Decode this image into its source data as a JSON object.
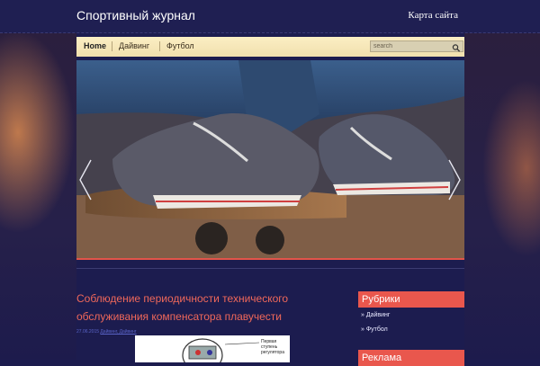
{
  "header": {
    "site_title": "Спортивный журнал",
    "sitemap_link": "Карта сайта"
  },
  "nav": {
    "items": [
      {
        "label": "Home",
        "active": true
      },
      {
        "label": "Дайвинг",
        "active": false
      },
      {
        "label": "Футбол",
        "active": false
      }
    ]
  },
  "search": {
    "placeholder": "search"
  },
  "slider": {
    "icons": {
      "prev": "chevron-left-icon",
      "next": "chevron-right-icon"
    },
    "accent": "#e2544a"
  },
  "post": {
    "title": "Соблюдение периодичности технического обслуживания компенсатора плавучести",
    "meta": {
      "date": "27.06.2015",
      "links": "Дайвинг, Дайвинг"
    },
    "image_caption": "Первая ступень регулятора"
  },
  "sidebar": {
    "widgets": [
      {
        "title": "Рубрики",
        "links": [
          "» Дайвинг",
          "» Футбол"
        ]
      },
      {
        "title": "Реклама"
      }
    ]
  },
  "colors": {
    "background": "#1c1c4f",
    "nav_bg": "#f6e6b8",
    "accent": "#e9574d",
    "post_title": "#f0685a"
  }
}
